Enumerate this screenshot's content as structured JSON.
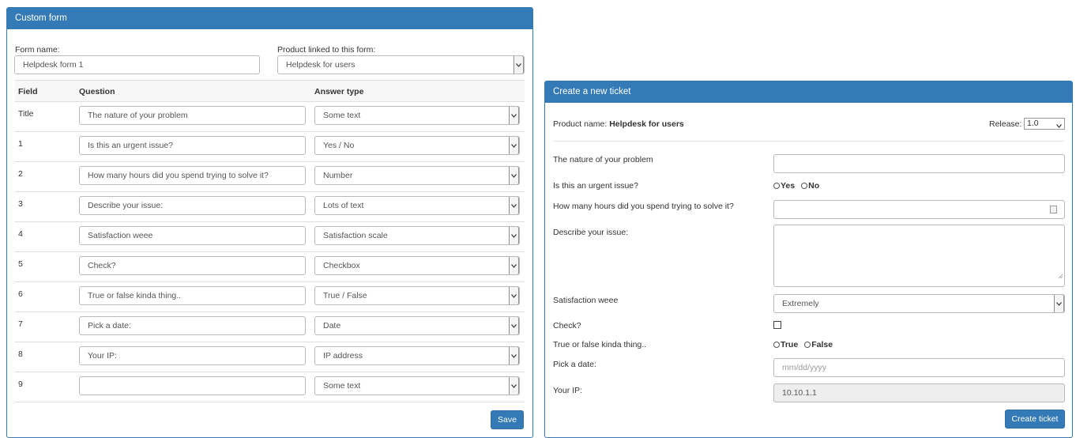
{
  "colors": {
    "primary": "#337ab7",
    "border": "#b9b9b9",
    "disabled_bg": "#eeeeee"
  },
  "custom_form": {
    "title": "Custom form",
    "form_name_label": "Form name:",
    "form_name_value": "Helpdesk form 1",
    "product_label": "Product linked to this form:",
    "product_value": "Helpdesk for users",
    "headers": {
      "field": "Field",
      "question": "Question",
      "answer_type": "Answer type"
    },
    "rows": [
      {
        "field": "Title",
        "question": "The nature of your problem",
        "answer_type": "Some text"
      },
      {
        "field": "1",
        "question": "Is this an urgent issue?",
        "answer_type": "Yes / No"
      },
      {
        "field": "2",
        "question": "How many hours did you spend trying to solve it?",
        "answer_type": "Number"
      },
      {
        "field": "3",
        "question": "Describe your issue:",
        "answer_type": "Lots of text"
      },
      {
        "field": "4",
        "question": "Satisfaction weee",
        "answer_type": "Satisfaction scale"
      },
      {
        "field": "5",
        "question": "Check?",
        "answer_type": "Checkbox"
      },
      {
        "field": "6",
        "question": "True or false kinda thing..",
        "answer_type": "True / False"
      },
      {
        "field": "7",
        "question": "Pick a date:",
        "answer_type": "Date"
      },
      {
        "field": "8",
        "question": "Your IP:",
        "answer_type": "IP address"
      },
      {
        "field": "9",
        "question": "",
        "answer_type": "Some text"
      }
    ],
    "save_label": "Save"
  },
  "ticket": {
    "title": "Create a new ticket",
    "product_name_label": "Product name:",
    "product_name_value": "Helpdesk for users",
    "release_label": "Release:",
    "release_value": "1.0",
    "q_nature": "The nature of your problem",
    "q_urgent": "Is this an urgent issue?",
    "yes_label": "Yes",
    "no_label": "No",
    "q_hours": "How many hours did you spend trying to solve it?",
    "q_describe": "Describe your issue:",
    "q_satisfaction": "Satisfaction weee",
    "satisfaction_value": "Extremely",
    "q_check": "Check?",
    "q_truefalse": "True or false kinda thing..",
    "true_label": "True",
    "false_label": "False",
    "q_date": "Pick a date:",
    "date_placeholder": "mm/dd/yyyy",
    "q_ip": "Your IP:",
    "ip_value": "10.10.1.1",
    "create_label": "Create ticket"
  }
}
